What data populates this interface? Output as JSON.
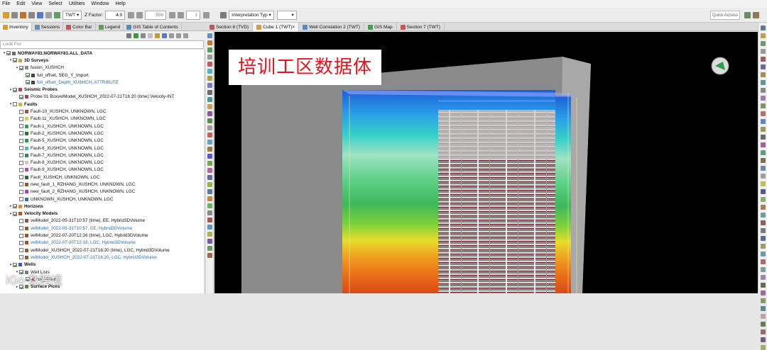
{
  "menu": [
    "File",
    "Edit",
    "View",
    "Select",
    "Utilities",
    "Window",
    "Help"
  ],
  "toolbar": {
    "domain": "TWT",
    "zfactor_label": "Z Factor:",
    "zfactor_value": "4.9",
    "frame_value": "556",
    "step_value": "1",
    "interp_type": "Interpretation Typ",
    "quick_access": "Quick Access"
  },
  "left_tabs": [
    "Inventory",
    "Sessions",
    "Color Bar",
    "Legend",
    "GIS Table of Contents"
  ],
  "search_placeholder": "Look For",
  "tree": [
    {
      "d": 0,
      "t": "v",
      "cb": "on",
      "sw": "#6b6b6b",
      "text": "NORWAY83.NORWAY83.ALL_DATA",
      "cls": "bold"
    },
    {
      "d": 1,
      "t": "v",
      "cb": "on",
      "sw": "#c8a24a",
      "text": "3D Surveys",
      "cls": "bold"
    },
    {
      "d": 2,
      "t": "v",
      "cb": "on",
      "sw": "#8a8a8a",
      "text": "fusion_XUSHCH",
      "cls": ""
    },
    {
      "d": 3,
      "t": "",
      "cb": "on",
      "sw": "#444",
      "text": "full_offset, SEG_Y_Import",
      "cls": ""
    },
    {
      "d": 3,
      "t": "",
      "cb": "on",
      "sw": "#444",
      "text": "full_offset_Depth_XUSHCH, ATTRIBUTE",
      "cls": "link"
    },
    {
      "d": 1,
      "t": "v",
      "cb": "on",
      "sw": "#a05050",
      "text": "Seismic Probes",
      "cls": "bold"
    },
    {
      "d": 2,
      "t": "",
      "cb": "on",
      "sw": "#b04040",
      "text": "Probe 01 BoxvelModel_XUSHCH_2022-07-21T16:20 (time):Velocity-INT",
      "cls": ""
    },
    {
      "d": 1,
      "t": "v",
      "cb": "",
      "sw": "#c8b24a",
      "text": "Faults",
      "cls": "bold"
    },
    {
      "d": 2,
      "t": "",
      "cb": "",
      "sw": "#b34a2a",
      "text": "Fault-10_XUSHCH, UNKNOWN, LGC",
      "cls": ""
    },
    {
      "d": 2,
      "t": "",
      "cb": "",
      "sw": "#d8d23a",
      "text": "Fault-11_XUSHCH, UNKNOWN, LGC",
      "cls": ""
    },
    {
      "d": 2,
      "t": "",
      "cb": "",
      "sw": "#2aa84a",
      "text": "Fault-1_XUSHCH, UNKNOWN, LGC",
      "cls": ""
    },
    {
      "d": 2,
      "t": "",
      "cb": "",
      "sw": "#1f7a3a",
      "text": "Fault-2_XUSHCH, UNKNOWN, LGC",
      "cls": ""
    },
    {
      "d": 2,
      "t": "",
      "cb": "",
      "sw": "#1e9e3e",
      "text": "Fault-5_XUSHCH, UNKNOWN, LGC",
      "cls": ""
    },
    {
      "d": 2,
      "t": "",
      "cb": "",
      "sw": "#3ac6c6",
      "text": "Fault-6_XUSHCH, UNKNOWN, LGC",
      "cls": ""
    },
    {
      "d": 2,
      "t": "",
      "cb": "",
      "sw": "#2a8a5a",
      "text": "Fault-7_XUSHCH, UNKNOWN, LGC",
      "cls": ""
    },
    {
      "d": 2,
      "t": "",
      "cb": "",
      "sw": "#e8b8c8",
      "text": "Fault-8_XUSHCH, UNKNOWN, LGC",
      "cls": ""
    },
    {
      "d": 2,
      "t": "",
      "cb": "",
      "sw": "#c23ad0",
      "text": "Fault-9_XUSHCH, UNKNOWN, LGC",
      "cls": ""
    },
    {
      "d": 2,
      "t": "",
      "cb": "",
      "sw": "#2a6a2a",
      "text": "Fault_XUSHCH, UNKNOWN, LGC",
      "cls": ""
    },
    {
      "d": 2,
      "t": "",
      "cb": "",
      "sw": "#8a5a2a",
      "text": "new_fault_1_RZHANG_XUSHCH, UNKNOWN, LGC",
      "cls": ""
    },
    {
      "d": 2,
      "t": "",
      "cb": "",
      "sw": "#c82ac8",
      "text": "new_fault_2_RZHANG_XUSHCH, UNKNOWN, LGC",
      "cls": ""
    },
    {
      "d": 2,
      "t": "",
      "cb": "",
      "sw": "#3a6ac8",
      "text": "UNKNOWN_XUSHCH, UNKNOWN, LGC",
      "cls": ""
    },
    {
      "d": 1,
      "t": ">",
      "cb": "on",
      "sw": "#c89a3a",
      "text": "Horizons",
      "cls": "bold"
    },
    {
      "d": 1,
      "t": "v",
      "cb": "on",
      "sw": "#b8522a",
      "text": "Velocity Models",
      "cls": "bold"
    },
    {
      "d": 2,
      "t": "",
      "cb": "",
      "sw": "#a0522a",
      "text": "velModel_2022-05-31T10:57 (time), EE, Hybrid3DVolume",
      "cls": ""
    },
    {
      "d": 2,
      "t": "",
      "cb": "",
      "sw": "#a0522a",
      "text": "velModel_2022-05-31T10:57, EE, Hybrid3DVolume",
      "cls": "link"
    },
    {
      "d": 2,
      "t": "",
      "cb": "",
      "sw": "#a0522a",
      "text": "velModel_2022-07-20T12:16 (time), LGC, Hybrid3DVolume",
      "cls": ""
    },
    {
      "d": 2,
      "t": "",
      "cb": "",
      "sw": "#a0522a",
      "text": "velModel_2022-07-20T12:16, LGC, Hybrid3DVolume",
      "cls": "link"
    },
    {
      "d": 2,
      "t": "",
      "cb": "",
      "sw": "#a0522a",
      "text": "velModel_XUSHCH_2022-07-21T16:20 (time), LGC, Hybrid3DVolume",
      "cls": ""
    },
    {
      "d": 2,
      "t": "",
      "cb": "",
      "sw": "#a0522a",
      "text": "velModel_XUSHCH_2022-07-21T16:20, LGC, Hybrid3DVolume",
      "cls": "link"
    },
    {
      "d": 1,
      "t": "v",
      "cb": "on",
      "sw": "#3a5ab8",
      "text": "Wells",
      "cls": "bold"
    },
    {
      "d": 2,
      "t": "v",
      "cb": "on",
      "sw": "#7a7a7a",
      "text": "Well Lists",
      "cls": ""
    },
    {
      "d": 3,
      "t": "",
      "cb": "on",
      "sw": "#c83a3a",
      "text": "full_offset",
      "cls": ""
    },
    {
      "d": 2,
      "t": ">",
      "cb": "on",
      "sw": "#5a8a3a",
      "text": "Surface Picks",
      "cls": "bold"
    }
  ],
  "view_tabs": [
    "Section 8 (TVD)",
    "Cube 1 (TWT)",
    "Well Correlation 2 (TWT)",
    "GIS Map",
    "Section 7 (TWT)"
  ],
  "view_active_index": 1,
  "viewport_title": "培训工区数据体",
  "watermark": "iGo 数跨境"
}
